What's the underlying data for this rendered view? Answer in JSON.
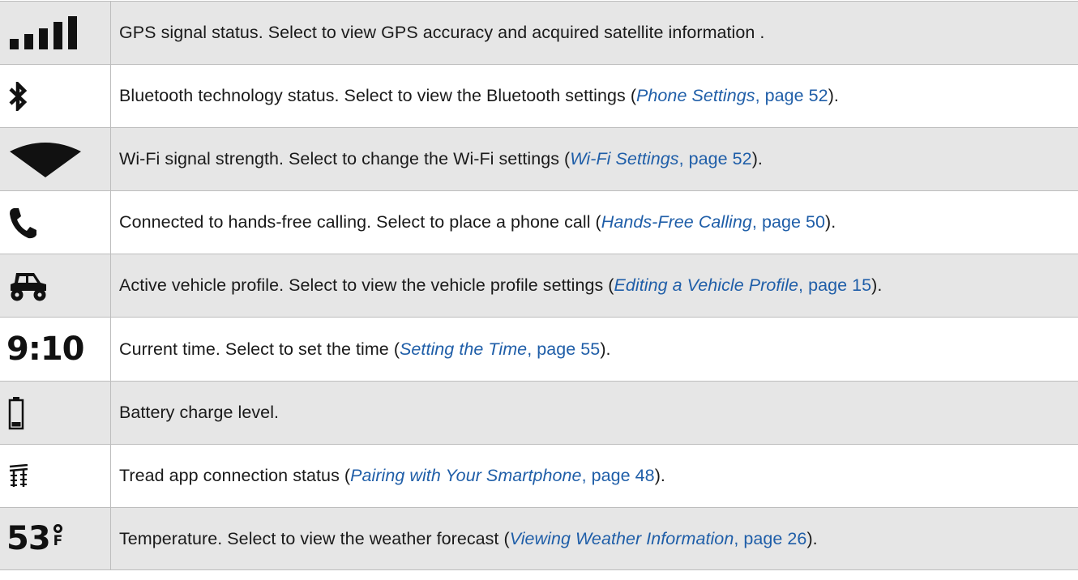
{
  "rows": [
    {
      "icon": "gps-signal-icon",
      "text": "GPS signal status. Select to view GPS accuracy and acquired satellite information .",
      "link": "",
      "suffix": ""
    },
    {
      "icon": "bluetooth-icon",
      "text": "Bluetooth technology status. Select to view the Bluetooth settings (",
      "link": "Phone Settings",
      "link_page": ", page 52",
      "suffix": ")."
    },
    {
      "icon": "wifi-icon",
      "text": "Wi-Fi signal strength. Select to change the Wi-Fi settings (",
      "link": "Wi-Fi Settings",
      "link_page": ", page 52",
      "suffix": ")."
    },
    {
      "icon": "phone-icon",
      "text": "Connected to hands-free calling. Select to place a phone call (",
      "link": "Hands-Free Calling",
      "link_page": ", page 50",
      "suffix": ")."
    },
    {
      "icon": "vehicle-icon",
      "text": "Active vehicle profile. Select to view the vehicle profile settings (",
      "link": "Editing a Vehicle Profile",
      "link_page": ", page 15",
      "suffix": ")."
    },
    {
      "icon": "clock-time",
      "icon_text": "9:10",
      "text": "Current time. Select to set the time (",
      "link": "Setting the Time",
      "link_page": ", page 55",
      "suffix": ")."
    },
    {
      "icon": "battery-icon",
      "text": "Battery charge level.",
      "link": "",
      "suffix": ""
    },
    {
      "icon": "tread-app-icon",
      "text": "Tread app connection status (",
      "link": "Pairing with Your Smartphone",
      "link_page": ", page 48",
      "suffix": ")."
    },
    {
      "icon": "temperature",
      "icon_text": "53",
      "icon_unit": "F",
      "text": "Temperature. Select to view the weather forecast (",
      "link": "Viewing Weather Information",
      "link_page": ", page 26",
      "suffix": ")."
    }
  ],
  "colors": {
    "shade": "#e6e6e6",
    "link": "#1f5ea8",
    "border": "#bdbdbd"
  }
}
